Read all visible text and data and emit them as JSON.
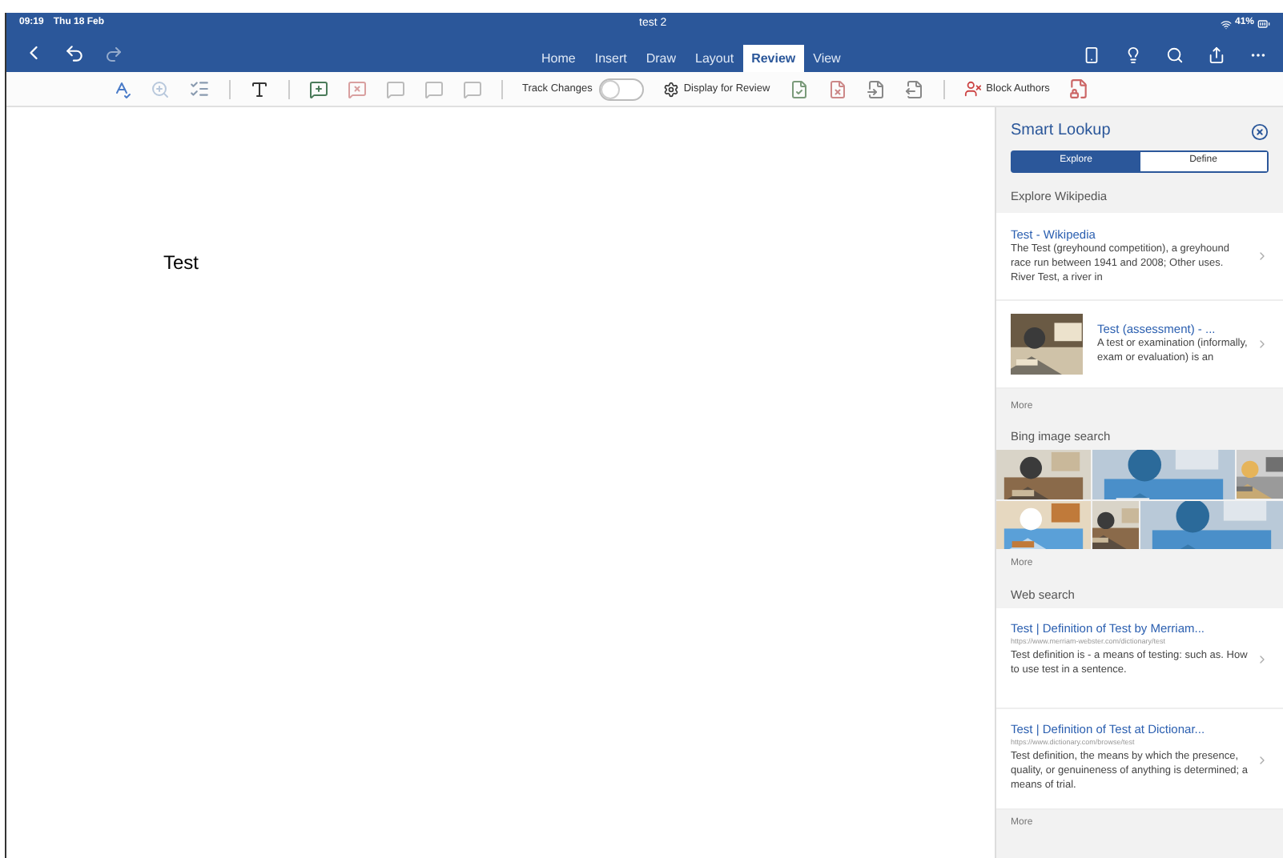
{
  "status_bar": {
    "time": "09:19",
    "date": "Thu 18 Feb",
    "battery": "41%"
  },
  "window": {
    "title": "test 2"
  },
  "tabs": [
    {
      "label": "Home",
      "selected": false
    },
    {
      "label": "Insert",
      "selected": false
    },
    {
      "label": "Draw",
      "selected": false
    },
    {
      "label": "Layout",
      "selected": false
    },
    {
      "label": "Review",
      "selected": true
    },
    {
      "label": "View",
      "selected": false
    }
  ],
  "toolbar": {
    "track_changes": {
      "label": "Track Changes",
      "on": false
    },
    "display_for_review": "Display for Review",
    "block_authors": "Block Authors"
  },
  "document": {
    "text": "Test"
  },
  "smart_lookup": {
    "title": "Smart Lookup",
    "segments": [
      {
        "label": "Explore",
        "selected": true
      },
      {
        "label": "Define",
        "selected": false
      }
    ],
    "wikipedia": {
      "heading": "Explore Wikipedia",
      "results": [
        {
          "kind": "text",
          "title": "Test - Wikipedia",
          "snippet": "The Test (greyhound competition), a greyhound race run between 1941 and 2008; Other uses. River Test, a river in"
        },
        {
          "kind": "picture",
          "title": "Test (assessment) - ...",
          "snippet": "A test or examination (informally, exam or evaluation) is an"
        }
      ],
      "more": "More"
    },
    "images": {
      "heading": "Bing image search",
      "more": "More"
    },
    "web": {
      "heading": "Web search",
      "results": [
        {
          "title": "Test | Definition of Test by Merriam...",
          "url": "https://www.merriam-webster.com/dictionary/test",
          "snippet": "Test definition is - a means of testing: such as. How to use test in a sentence."
        },
        {
          "title": "Test | Definition of Test at Dictionar...",
          "url": "https://www.dictionary.com/browse/test",
          "snippet": "Test definition, the means by which the presence, quality, or genuineness of anything is determined; a means of trial."
        }
      ],
      "more": "More"
    }
  }
}
